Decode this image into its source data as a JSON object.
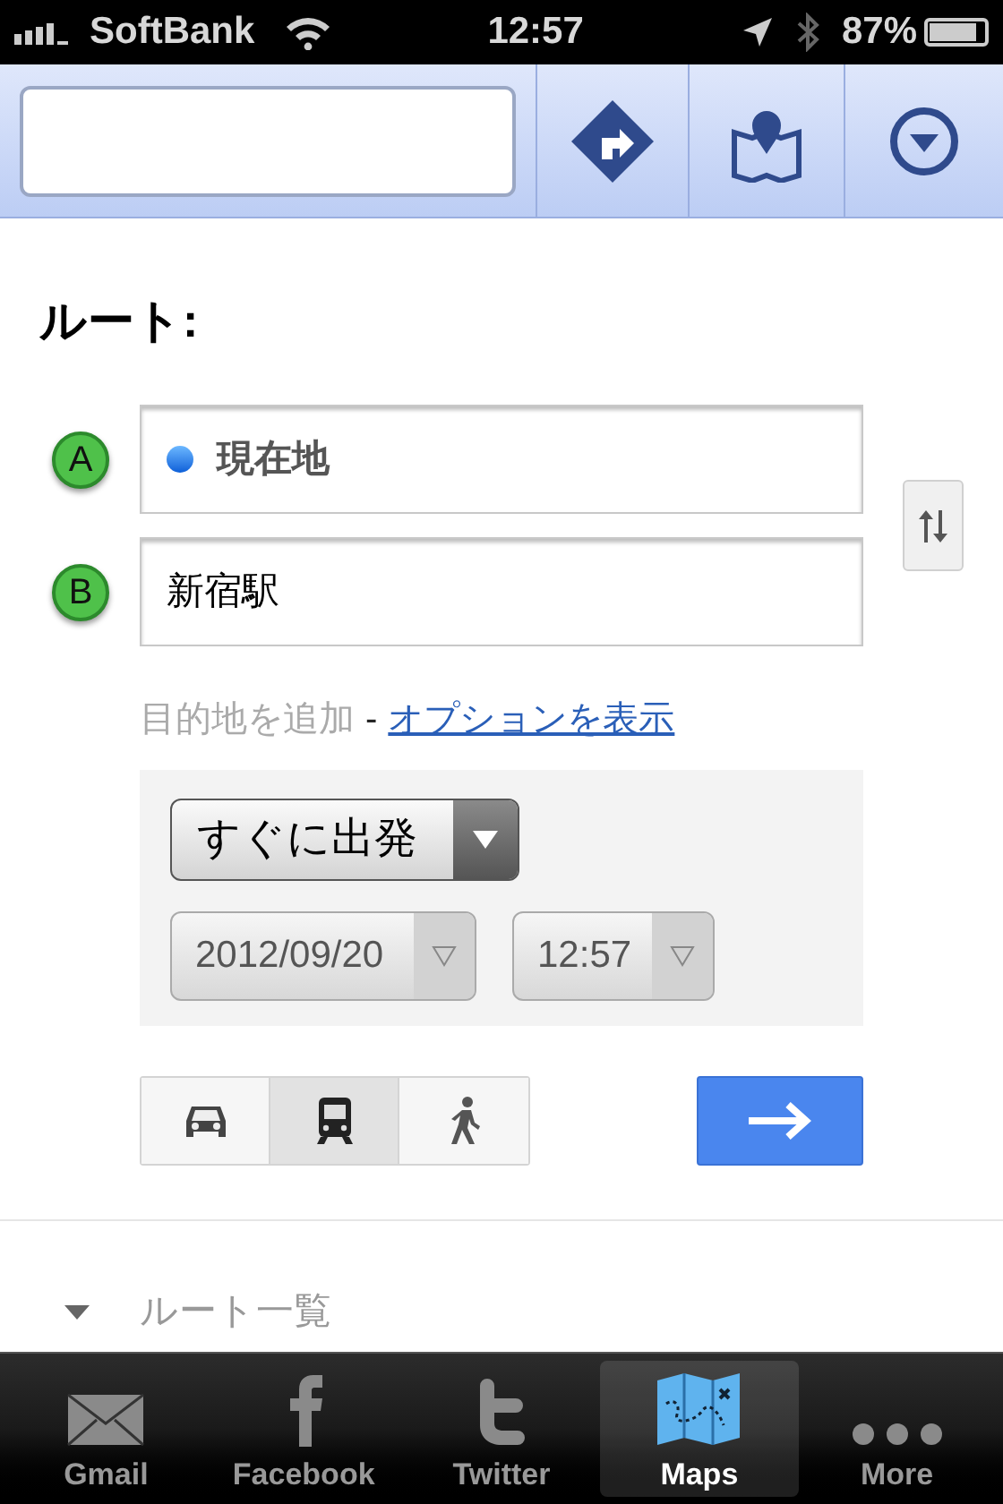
{
  "status_bar": {
    "carrier": "SoftBank",
    "time": "12:57",
    "battery": "87%"
  },
  "route": {
    "title": "ルート:",
    "endpoints": [
      {
        "marker": "A",
        "kind": "current-location",
        "value": "現在地"
      },
      {
        "marker": "B",
        "kind": "text",
        "value": "新宿駅"
      }
    ],
    "add_destination": "目的地を追加",
    "separator": "-",
    "options_link": "オプションを表示",
    "departure": "すぐに出発",
    "date": "2012/09/20",
    "time": "12:57",
    "modes": [
      {
        "kind": "car",
        "selected": false
      },
      {
        "kind": "transit",
        "selected": true
      },
      {
        "kind": "walk",
        "selected": false
      }
    ],
    "route_list": {
      "label": "ルート一覧",
      "expanded": true
    }
  },
  "tab_bar": [
    {
      "kind": "mail",
      "label": "Gmail",
      "selected": false
    },
    {
      "kind": "facebook",
      "label": "Facebook",
      "selected": false
    },
    {
      "kind": "twitter",
      "label": "Twitter",
      "selected": false
    },
    {
      "kind": "maps",
      "label": "Maps",
      "selected": true
    },
    {
      "kind": "more",
      "label": "More",
      "selected": false
    }
  ]
}
